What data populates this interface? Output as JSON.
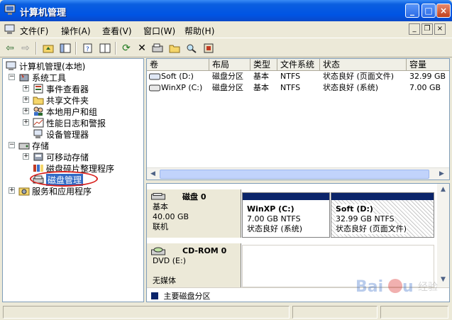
{
  "window": {
    "title": "计算机管理"
  },
  "menu": [
    "文件(F)",
    "操作(A)",
    "查看(V)",
    "窗口(W)",
    "帮助(H)"
  ],
  "tree": {
    "root": "计算机管理(本地)",
    "system_tools": "系统工具",
    "event_viewer": "事件查看器",
    "shared_folders": "共享文件夹",
    "local_users": "本地用户和组",
    "perf_logs": "性能日志和警报",
    "device_manager": "设备管理器",
    "storage": "存储",
    "removable": "可移动存储",
    "defrag": "磁盘碎片整理程序",
    "disk_mgmt": "磁盘管理",
    "services": "服务和应用程序"
  },
  "volumes": {
    "columns": [
      "卷",
      "布局",
      "类型",
      "文件系统",
      "状态",
      "容量"
    ],
    "rows": [
      {
        "name": "Soft (D:)",
        "layout": "磁盘分区",
        "type": "基本",
        "fs": "NTFS",
        "status": "状态良好 (页面文件)",
        "capacity": "32.99 GB"
      },
      {
        "name": "WinXP (C:)",
        "layout": "磁盘分区",
        "type": "基本",
        "fs": "NTFS",
        "status": "状态良好 (系统)",
        "capacity": "7.00 GB"
      }
    ]
  },
  "disks": {
    "disk0": {
      "name": "磁盘 0",
      "type": "基本",
      "size": "40.00 GB",
      "state": "联机"
    },
    "p1": {
      "name": "WinXP  (C:)",
      "size": "7.00 GB NTFS",
      "status": "状态良好 (系统)"
    },
    "p2": {
      "name": "Soft   (D:)",
      "size": "32.99 GB NTFS",
      "status": "状态良好 (页面文件)"
    },
    "cdrom": {
      "name": "CD-ROM 0",
      "type": "DVD (E:)",
      "media": "无媒体"
    }
  },
  "legend": "主要磁盘分区",
  "colors": {
    "titlebar": "#0054e3",
    "selection": "#316ac5",
    "partition": "#0a246a",
    "highlight_ring": "#d8201c"
  }
}
